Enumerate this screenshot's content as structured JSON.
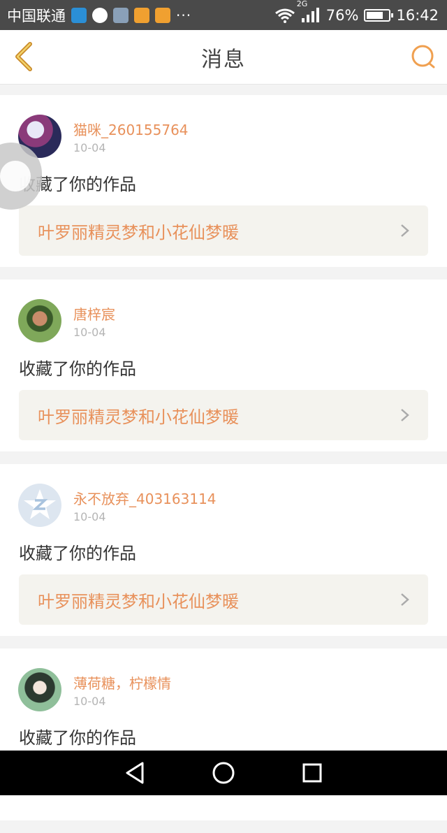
{
  "status_bar": {
    "carrier": "中国联通",
    "signal_type": "2G",
    "battery": "76%",
    "battery_level": 0.76,
    "time": "16:42",
    "more": "···"
  },
  "header": {
    "title": "消息",
    "back_icon": "chevron-left-icon",
    "search_icon": "search-icon"
  },
  "messages": [
    {
      "user": "猫咪_260155764",
      "date": "10-04",
      "action": "收藏了你的作品",
      "work": "叶罗丽精灵梦和小花仙梦暖"
    },
    {
      "user": "唐梓宸",
      "date": "10-04",
      "action": "收藏了你的作品",
      "work": "叶罗丽精灵梦和小花仙梦暖"
    },
    {
      "user": "永不放弃_403163114",
      "date": "10-04",
      "action": "收藏了你的作品",
      "work": "叶罗丽精灵梦和小花仙梦暖"
    },
    {
      "user": "薄荷糖，柠檬情",
      "date": "10-04",
      "action": "收藏了你的作品",
      "work": ""
    }
  ],
  "nav_bar": {
    "back_icon": "triangle-back-icon",
    "home_icon": "circle-home-icon",
    "recents_icon": "square-recents-icon"
  },
  "colors": {
    "accent": "#e8915b",
    "status_bar": "#4a4a4a",
    "link_bg": "#f4f3ee"
  }
}
